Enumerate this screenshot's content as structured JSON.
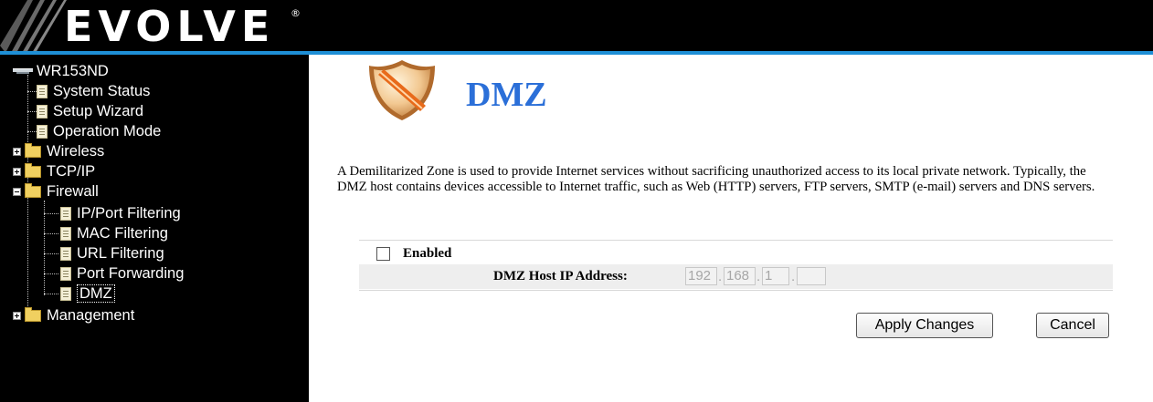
{
  "brand": {
    "name": "EVOLVE",
    "mark": "®"
  },
  "sidebar": {
    "root": "WR153ND",
    "items": [
      {
        "label": "System Status"
      },
      {
        "label": "Setup Wizard"
      },
      {
        "label": "Operation Mode"
      },
      {
        "label": "Wireless"
      },
      {
        "label": "TCP/IP"
      },
      {
        "label": "Firewall"
      },
      {
        "label": "IP/Port Filtering"
      },
      {
        "label": "MAC Filtering"
      },
      {
        "label": "URL Filtering"
      },
      {
        "label": "Port Forwarding"
      },
      {
        "label": "DMZ"
      },
      {
        "label": "Management"
      }
    ]
  },
  "main": {
    "title": "DMZ",
    "description": "A Demilitarized Zone is used to provide Internet services without sacrificing unauthorized access to its local private network. Typically, the DMZ host contains devices accessible to Internet traffic, such as Web (HTTP) servers, FTP servers, SMTP (e-mail) servers and DNS servers.",
    "enabled_label": "Enabled",
    "enabled_checked": false,
    "ip_label": "DMZ Host IP Address:",
    "ip_octets": [
      "192",
      "168",
      "1",
      ""
    ],
    "apply_label": "Apply Changes",
    "cancel_label": "Cancel"
  },
  "colors": {
    "accent_line": "#1e8fd6",
    "title": "#2b6fd8",
    "sidebar_bg": "#000000"
  }
}
